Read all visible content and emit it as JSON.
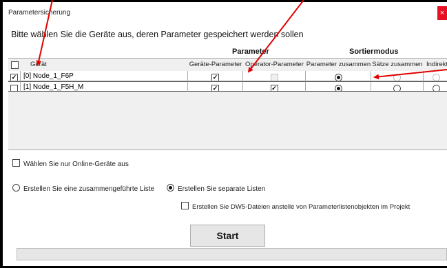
{
  "window": {
    "title": "Parametersicherung",
    "close_glyph": "×"
  },
  "instruction": "Bitte wählen Sie die Geräte aus, deren Parameter gespeichert werden sollen",
  "group_headers": {
    "parameter": "Parameter",
    "sortiermodus": "Sortiermodus"
  },
  "columns": {
    "geraet": "Gerät",
    "geraete_parameter": "Geräte-Parameter",
    "operator_parameter": "Operator-Parameter",
    "parameter_zusammen": "Parameter zusammen",
    "saetze_zusammen": "Sätze zusammen",
    "indirekt": "Indirekt"
  },
  "select_all_checked": false,
  "rows": [
    {
      "checked": true,
      "name": "[0] Node_1_F6P",
      "geraete_parameter": true,
      "operator_parameter": false,
      "operator_disabled": true,
      "sort_mode": "parameter_zusammen",
      "selected": false
    },
    {
      "checked": false,
      "name": "[1] Node_1_F5H_M",
      "geraete_parameter": true,
      "operator_parameter": true,
      "operator_disabled": false,
      "sort_mode": "parameter_zusammen",
      "selected": true
    }
  ],
  "online_only": {
    "label": "Wählen Sie nur Online-Geräte aus",
    "checked": false
  },
  "list_mode": {
    "combined_label": "Erstellen Sie eine zusammengeführte Liste",
    "separate_label": "Erstellen Sie separate Listen",
    "selected": "separate"
  },
  "dw5_option": {
    "label": "Erstellen Sie DW5-Dateien anstelle von Parameterlistenobjekten im Projekt",
    "checked": false
  },
  "start_button": "Start",
  "progress": {
    "value": 0
  },
  "annotation_color": "#e00000"
}
